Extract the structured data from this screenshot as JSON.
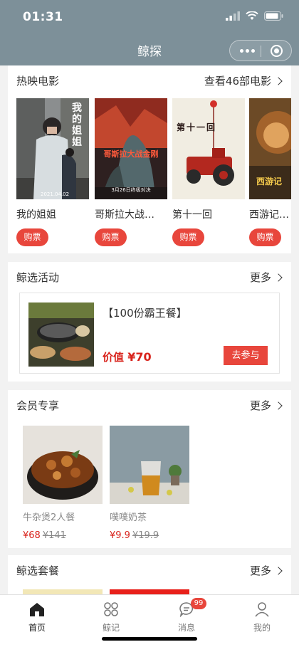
{
  "status": {
    "time": "01:31"
  },
  "nav": {
    "title": "鲸探"
  },
  "movies": {
    "title": "热映电影",
    "more": "查看46部电影",
    "items": [
      {
        "name": "我的姐姐",
        "buy": "购票",
        "poster_text": "我的姐姐",
        "poster_date": "2021.04.02"
      },
      {
        "name": "哥斯拉大战…",
        "buy": "购票",
        "poster_text": "哥斯拉大战金刚",
        "poster_date": "3月26日终极对决"
      },
      {
        "name": "第十一回",
        "buy": "购票",
        "poster_text": "第十一回"
      },
      {
        "name": "西游记…",
        "buy": "购票",
        "poster_text": "西游记"
      }
    ]
  },
  "activity": {
    "title": "鲸选活动",
    "more": "更多",
    "item": {
      "name": "【100份霸王餐】",
      "price_label": "价值",
      "price": "¥70",
      "join": "去参与"
    }
  },
  "vip": {
    "title": "会员专享",
    "more": "更多",
    "items": [
      {
        "name": "牛杂煲2人餐",
        "price": "¥68",
        "old_price": "¥141"
      },
      {
        "name": "噗噗奶茶",
        "price": "¥9.9",
        "old_price": "¥19.9"
      }
    ]
  },
  "sets": {
    "title": "鲸选套餐",
    "more": "更多"
  },
  "tabbar": {
    "items": [
      {
        "label": "首页",
        "icon": "home-icon"
      },
      {
        "label": "鲸记",
        "icon": "grid-icon"
      },
      {
        "label": "消息",
        "icon": "message-icon",
        "badge": "99"
      },
      {
        "label": "我的",
        "icon": "user-icon"
      }
    ]
  },
  "colors": {
    "nav_bg": "#7d9099",
    "accent": "#e8463c",
    "price": "#d8221b"
  }
}
